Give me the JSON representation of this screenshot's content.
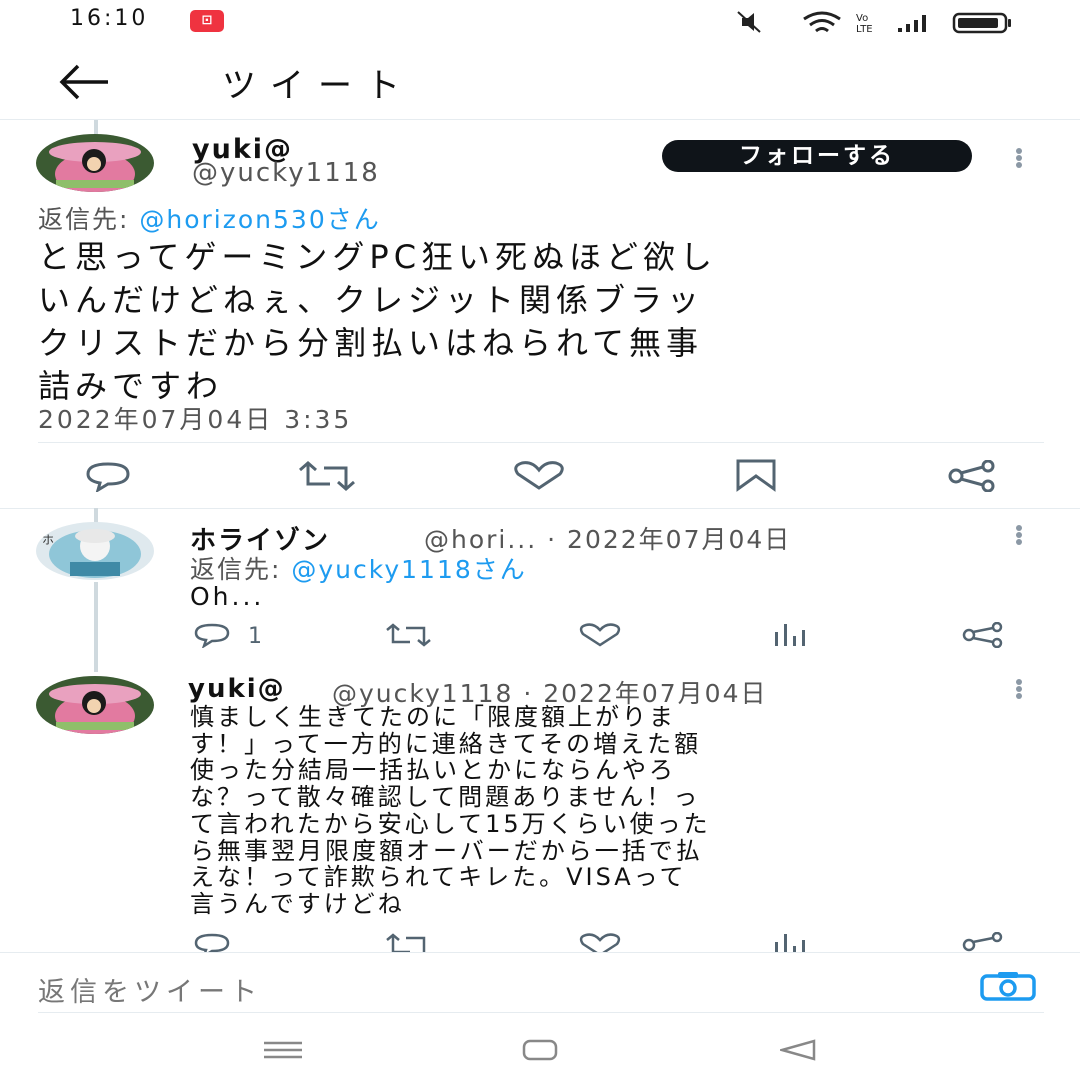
{
  "status_bar": {
    "time": "16:10",
    "battery_label": ""
  },
  "header": {
    "title": "ツイート"
  },
  "main_tweet": {
    "display_name": "yuki@",
    "handle": "@yucky1118",
    "follow_label": "フォローする",
    "reply_to_prefix": "返信先: ",
    "reply_to_mention": "@horizon530さん",
    "text_lines": [
      "と思ってゲーミングPC狂い死ぬほど欲し",
      "いんだけどねぇ、クレジット関係ブラッ",
      "クリストだから分割払いはねられて無事",
      "詰みですわ"
    ],
    "timestamp": "2022年07月04日 3:35"
  },
  "replies": [
    {
      "display_name": "ホライゾン",
      "handle_date": "@hori... · 2022年07月04日",
      "reply_to_prefix": "返信先: ",
      "reply_to_mention": "@yucky1118さん",
      "text_lines": [
        "Oh..."
      ],
      "reply_count": "1"
    },
    {
      "display_name": "yuki@",
      "handle_date": "@yucky1118 · 2022年07月04日",
      "text_lines": [
        "慎ましく生きてたのに「限度額上がりま",
        "す！」って一方的に連絡きてその増えた額",
        "使った分結局一括払いとかにならんやろ",
        "な？って散々確認して問題ありません！っ",
        "て言われたから安心して15万くらい使った",
        "ら無事翌月限度額オーバーだから一括で払",
        "えな！って詐欺られてキレた。VISAって",
        "言うんですけどね"
      ]
    }
  ],
  "composer": {
    "placeholder": "返信をツイート"
  },
  "colors": {
    "accent": "#1d9bf0",
    "text": "#0f1419",
    "muted": "#536471",
    "status_badge": "#ef3340"
  }
}
